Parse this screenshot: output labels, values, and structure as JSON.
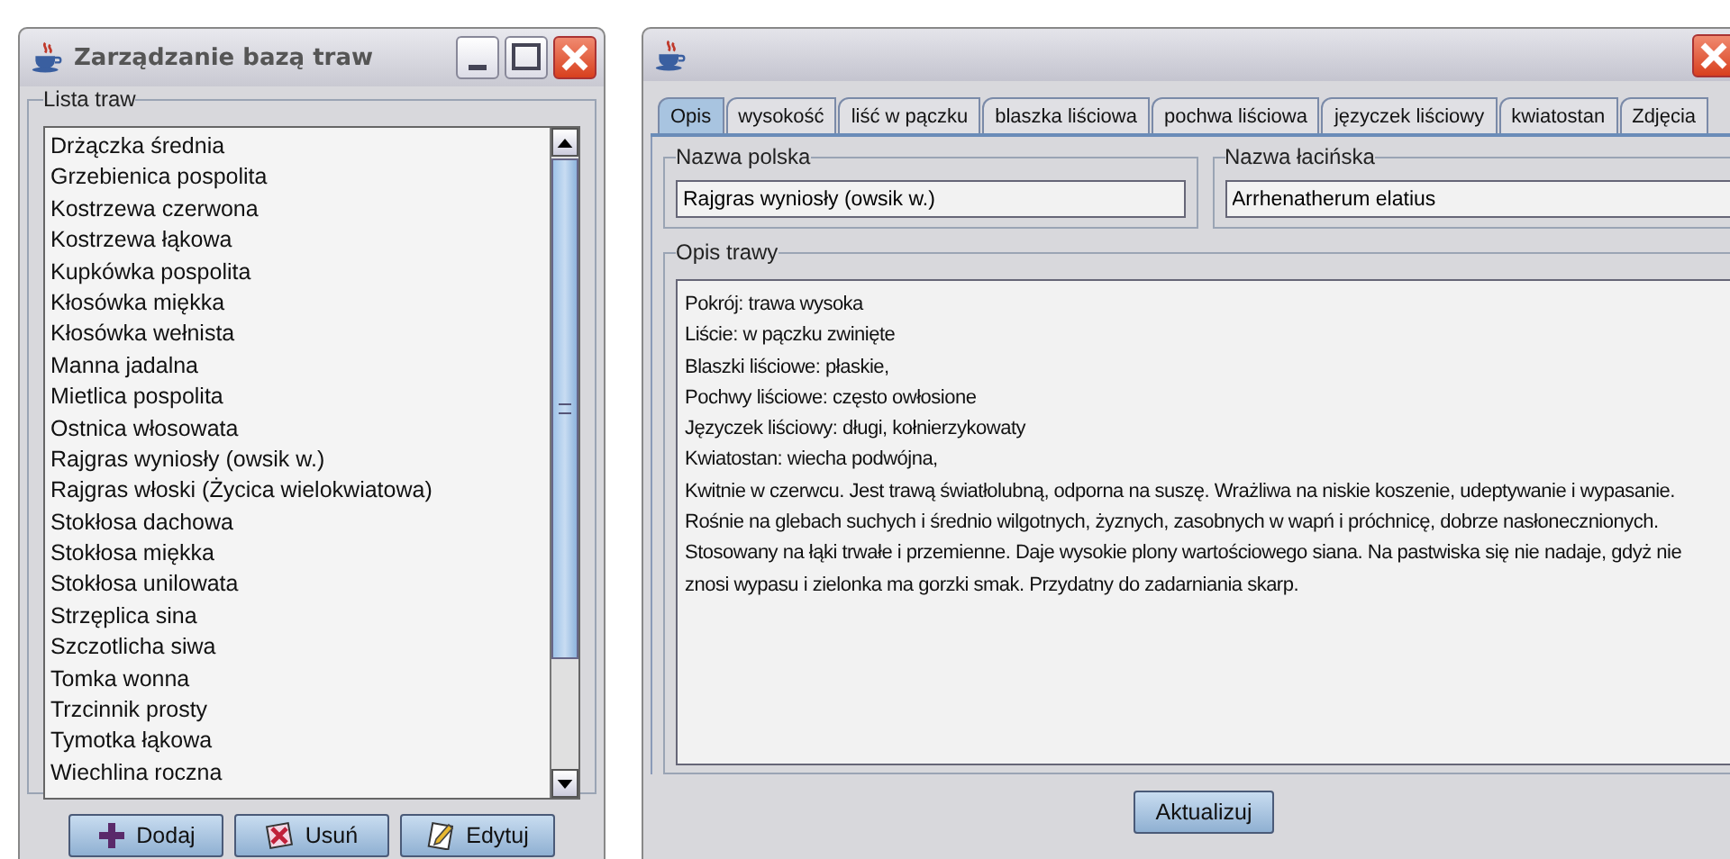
{
  "list_window": {
    "title": "Zarządzanie bazą traw",
    "group_label": "Lista traw",
    "items": [
      {
        "label": "Drżączka średnia",
        "selected": false
      },
      {
        "label": "Grzebienica pospolita",
        "selected": false
      },
      {
        "label": "Kostrzewa czerwona",
        "selected": false
      },
      {
        "label": "Kostrzewa łąkowa",
        "selected": false
      },
      {
        "label": "Kupkówka pospolita",
        "selected": false
      },
      {
        "label": "Kłosówka miękka",
        "selected": false
      },
      {
        "label": "Kłosówka wełnista",
        "selected": false
      },
      {
        "label": "Manna jadalna",
        "selected": false
      },
      {
        "label": "Mietlica pospolita",
        "selected": false
      },
      {
        "label": "Ostnica włosowata",
        "selected": false
      },
      {
        "label": "Rajgras wyniosły (owsik w.)",
        "selected": false
      },
      {
        "label": "Rajgras włoski (Życica wielokwiatowa)",
        "selected": false
      },
      {
        "label": "Stokłosa dachowa",
        "selected": false
      },
      {
        "label": "Stokłosa miękka",
        "selected": false
      },
      {
        "label": "Stokłosa unilowata",
        "selected": false
      },
      {
        "label": "Strzęplica sina",
        "selected": false
      },
      {
        "label": "Szczotlicha siwa",
        "selected": false
      },
      {
        "label": "Tomka wonna",
        "selected": false
      },
      {
        "label": "Trzcinnik prosty",
        "selected": false
      },
      {
        "label": "Tymotka łąkowa",
        "selected": false
      },
      {
        "label": "Wiechlina roczna",
        "selected": false
      }
    ],
    "buttons": [
      {
        "label": "Dodaj",
        "kind": "add"
      },
      {
        "label": "Usuń",
        "kind": "delete"
      },
      {
        "label": "Edytuj",
        "kind": "edit"
      }
    ]
  },
  "detail_window": {
    "tabs": [
      {
        "label": "Opis",
        "selected": true
      },
      {
        "label": "wysokość",
        "selected": false
      },
      {
        "label": "liść w pączku",
        "selected": false
      },
      {
        "label": "blaszka liściowa",
        "selected": false
      },
      {
        "label": "pochwa liściowa",
        "selected": false
      },
      {
        "label": "języczek liściowy",
        "selected": false
      },
      {
        "label": "kwiatostan",
        "selected": false
      },
      {
        "label": "Zdjęcia",
        "selected": false
      }
    ],
    "polish_name": {
      "label": "Nazwa polska",
      "value": "Rajgras wyniosły (owsik w.)"
    },
    "latin_name": {
      "label": "Nazwa łacińska",
      "value": "Arrhenatherum elatius"
    },
    "description": {
      "label": "Opis trawy",
      "lines": [
        "Pokrój: trawa wysoka",
        "Liście: w pączku zwinięte",
        "Blaszki liściowe: płaskie,",
        "Pochwy liściowe: często owłosione",
        "Języczek liściowy: długi, kołnierzykowaty",
        "Kwiatostan: wiecha podwójna,",
        "Kwitnie w czerwcu. Jest trawą światłolubną, odporna na suszę. Wrażliwa na niskie koszenie, udeptywanie i wypasanie.",
        "Rośnie na glebach suchych i średnio wilgotnych, żyznych, zasobnych w wapń i próchnicę, dobrze nasłonecznionych.",
        "Stosowany na łąki trwałe i przemienne. Daje wysokie plony wartościowego siana. Na pastwiska się nie nadaje, gdyż nie",
        "znosi wypasu i zielonka ma gorzki smak. Przydatny do zadarniania skarp."
      ]
    },
    "update_button": "Aktualizuj"
  }
}
